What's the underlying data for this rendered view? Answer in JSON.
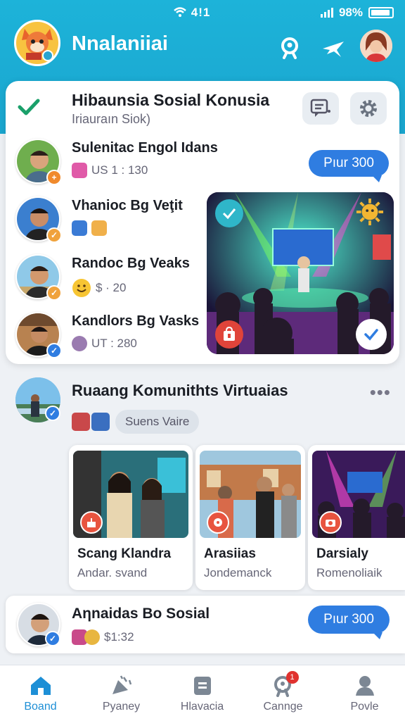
{
  "status_bar": {
    "center": "4!1",
    "battery": "98%"
  },
  "app": {
    "title": "Nnalaniiai"
  },
  "group_card": {
    "title": "Hibaunsia Sosial Konusia",
    "subtitle": "Iriauraın Siok)",
    "members": [
      {
        "name": "Sulenitac Engol Idans",
        "meta": "US 1 : 130",
        "badge_color": "#f08a2c"
      },
      {
        "name": "Vhanioc Bg Veţit",
        "meta": "",
        "badge_color": "#f0a23c"
      },
      {
        "name": "Randoc Bg Veaks",
        "meta": "$ · 20",
        "badge_color": "#f0a23c"
      },
      {
        "name": "Kandlors Bg Vasks",
        "meta": "UT : 280",
        "badge_color": "#2f7de1"
      }
    ],
    "action_button": "Pıur 300"
  },
  "community": {
    "title": "Ruaang Komunithts Virtuaias",
    "chip": "Suens Vaire",
    "tiles": [
      {
        "title": "Scang Klandra",
        "subtitle": "Andar. svand"
      },
      {
        "title": "Arasiias",
        "subtitle": "Jondemanck"
      },
      {
        "title": "Darsialy",
        "subtitle": "Romenoliaik"
      }
    ]
  },
  "bottom_card": {
    "name": "Aηnaidas Bo Sosial",
    "meta": "$1:32",
    "action_button": "Pıur 300"
  },
  "bottom_nav": {
    "items": [
      {
        "label": "Boand"
      },
      {
        "label": "Pyaney"
      },
      {
        "label": "Hlavacia"
      },
      {
        "label": "Cannge"
      },
      {
        "label": "Povle"
      }
    ],
    "active_index": 0,
    "notification_count": "1"
  },
  "colors": {
    "header": "#1db3d9",
    "accent": "#2f7de1",
    "check": "#1aa06a"
  }
}
